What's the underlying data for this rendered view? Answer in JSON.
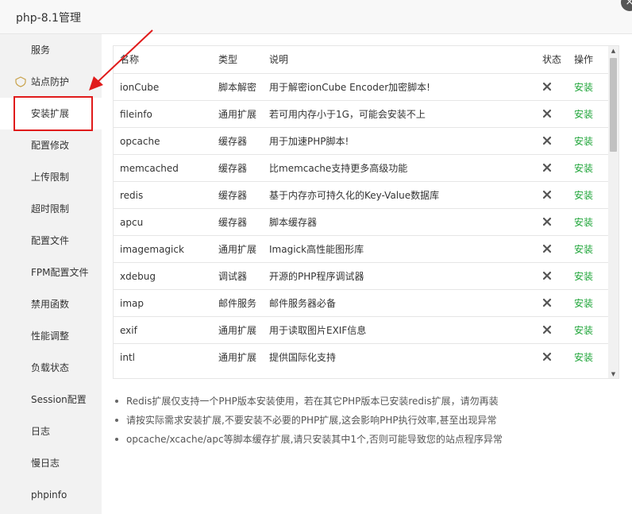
{
  "window": {
    "title": "php-8.1管理",
    "close_label": "×"
  },
  "sidebar": {
    "items": [
      {
        "label": "服务"
      },
      {
        "label": "站点防护",
        "icon": "shield-icon"
      },
      {
        "label": "安装扩展",
        "active": true
      },
      {
        "label": "配置修改"
      },
      {
        "label": "上传限制"
      },
      {
        "label": "超时限制"
      },
      {
        "label": "配置文件"
      },
      {
        "label": "FPM配置文件"
      },
      {
        "label": "禁用函数"
      },
      {
        "label": "性能调整"
      },
      {
        "label": "负载状态"
      },
      {
        "label": "Session配置"
      },
      {
        "label": "日志"
      },
      {
        "label": "慢日志"
      },
      {
        "label": "phpinfo"
      }
    ]
  },
  "table": {
    "headers": {
      "name": "名称",
      "type": "类型",
      "desc": "说明",
      "status": "状态",
      "action": "操作"
    },
    "rows": [
      {
        "name": "ionCube",
        "type": "脚本解密",
        "desc": "用于解密ionCube Encoder加密脚本!",
        "status": "not-installed",
        "action": "安装"
      },
      {
        "name": "fileinfo",
        "type": "通用扩展",
        "desc": "若可用内存小于1G，可能会安装不上",
        "status": "not-installed",
        "action": "安装"
      },
      {
        "name": "opcache",
        "type": "缓存器",
        "desc": "用于加速PHP脚本!",
        "status": "not-installed",
        "action": "安装"
      },
      {
        "name": "memcached",
        "type": "缓存器",
        "desc": "比memcache支持更多高级功能",
        "status": "not-installed",
        "action": "安装"
      },
      {
        "name": "redis",
        "type": "缓存器",
        "desc": "基于内存亦可持久化的Key-Value数据库",
        "status": "not-installed",
        "action": "安装"
      },
      {
        "name": "apcu",
        "type": "缓存器",
        "desc": "脚本缓存器",
        "status": "not-installed",
        "action": "安装"
      },
      {
        "name": "imagemagick",
        "type": "通用扩展",
        "desc": "Imagick高性能图形库",
        "status": "not-installed",
        "action": "安装"
      },
      {
        "name": "xdebug",
        "type": "调试器",
        "desc": "开源的PHP程序调试器",
        "status": "not-installed",
        "action": "安装"
      },
      {
        "name": "imap",
        "type": "邮件服务",
        "desc": "邮件服务器必备",
        "status": "not-installed",
        "action": "安装"
      },
      {
        "name": "exif",
        "type": "通用扩展",
        "desc": "用于读取图片EXIF信息",
        "status": "not-installed",
        "action": "安装"
      },
      {
        "name": "intl",
        "type": "通用扩展",
        "desc": "提供国际化支持",
        "status": "not-installed",
        "action": "安装"
      }
    ]
  },
  "notes": [
    "Redis扩展仅支持一个PHP版本安装使用，若在其它PHP版本已安装redis扩展，请勿再装",
    "请按实际需求安装扩展,不要安装不必要的PHP扩展,这会影响PHP执行效率,甚至出现异常",
    "opcache/xcache/apc等脚本缓存扩展,请只安装其中1个,否则可能导致您的站点程序异常"
  ],
  "colors": {
    "install_link": "#20a53a",
    "highlight": "#e01b1b",
    "sidebar_bg": "#f2f2f2",
    "titlebar_bg": "#f8f8f8"
  }
}
